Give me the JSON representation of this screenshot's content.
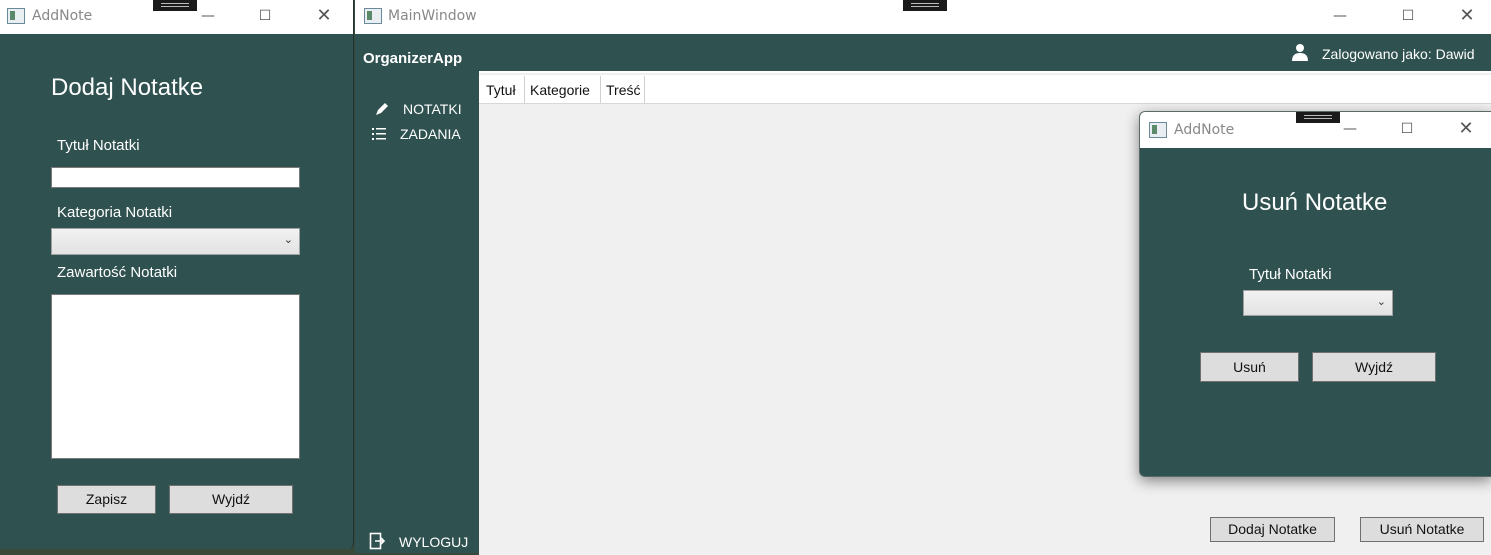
{
  "left_window": {
    "title": "AddNote",
    "heading": "Dodaj Notatke",
    "title_label": "Tytuł Notatki",
    "title_value": "",
    "category_label": "Kategoria Notatki",
    "category_value": "",
    "content_label": "Zawartość Notatki",
    "content_value": "",
    "save_label": "Zapisz",
    "exit_label": "Wyjdź"
  },
  "main_window": {
    "title": "MainWindow",
    "app_name": "OrganizerApp",
    "user_text": "Zalogowano jako: Dawid",
    "nav": [
      {
        "label": "NOTATKI",
        "icon": "pencil-icon"
      },
      {
        "label": "ZADANIA",
        "icon": "list-icon"
      }
    ],
    "logout_label": "WYLOGUJ",
    "columns": [
      "Tytuł",
      "Kategorie",
      "Treść"
    ],
    "add_note_label": "Dodaj Notatke",
    "delete_note_label": "Usuń Notatke"
  },
  "dialog": {
    "title": "AddNote",
    "heading": "Usuń Notatke",
    "title_label": "Tytuł Notatki",
    "title_value": "",
    "delete_label": "Usuń",
    "exit_label": "Wyjdź"
  },
  "colors": {
    "panel": "#2f5150",
    "grid_bg": "#f0f0f0"
  }
}
